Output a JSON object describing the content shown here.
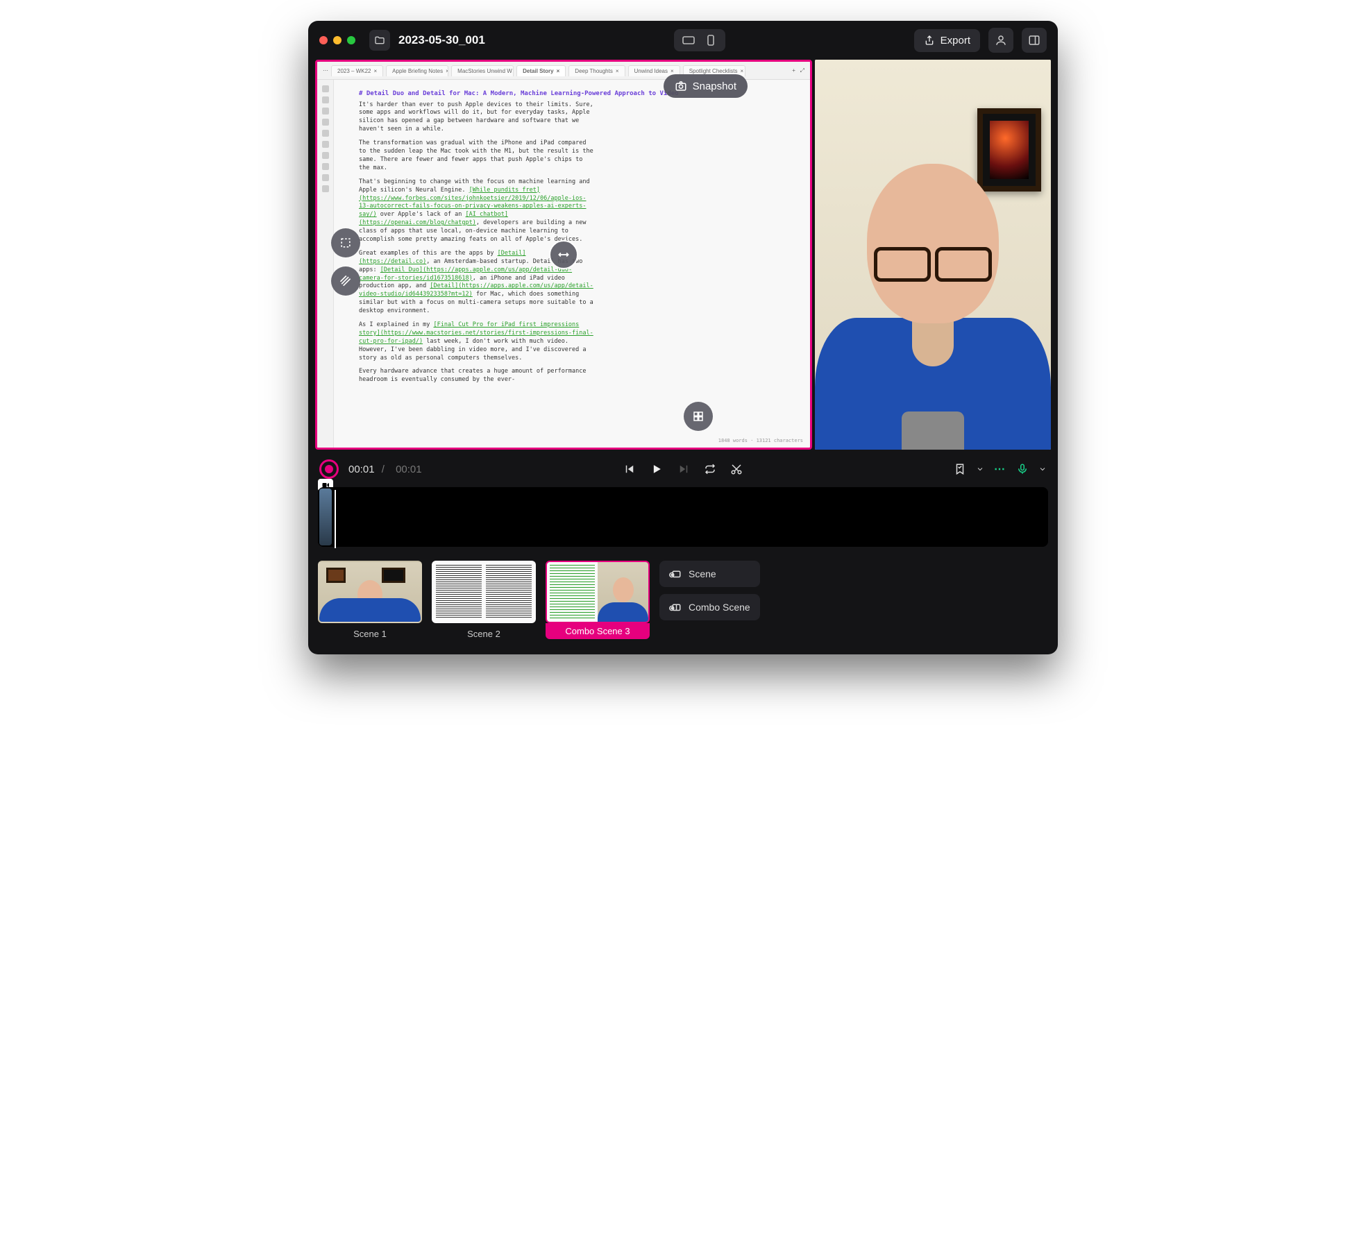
{
  "titlebar": {
    "project_name": "2023-05-30_001",
    "export_label": "Export"
  },
  "snapshot": {
    "label": "Snapshot"
  },
  "doc": {
    "tabs": [
      "2023 – WK22",
      "Apple Briefing Notes",
      "MacStories Unwind W…",
      "Detail Story",
      "Deep Thoughts",
      "Unwind Ideas",
      "Spotlight Checklists"
    ],
    "active_tab_index": 3,
    "heading": "# Detail Duo and Detail for Mac: A Modern, Machine Learning-Powered Approach to Video",
    "p1": "It's harder than ever to push Apple devices to their limits. Sure, some apps and workflows will do it, but for everyday tasks, Apple silicon has opened a gap between hardware and software that we haven't seen in a while.",
    "p2": "The transformation was gradual with the iPhone and iPad compared to the sudden leap the Mac took with the M1, but the result is the same. There are fewer and fewer apps that push Apple's chips to the max.",
    "p3a": "That's beginning to change with the focus on machine learning and Apple silicon's Neural Engine. ",
    "p3link1": "[While pundits fret](https://www.forbes.com/sites/johnkoetsier/2019/12/06/apple-ios-13-autocorrect-fails-focus-on-privacy-weakens-apples-ai-experts-say/)",
    "p3b": " over Apple's lack of an ",
    "p3link2": "[AI chatbot](https://openai.com/blog/chatgpt)",
    "p3c": ", developers are building a new class of apps that use local, on-device machine learning to accomplish some pretty amazing feats on all of Apple's devices.",
    "p4a": "Great examples of this are the apps by ",
    "p4link1": "[Detail](https://detail.co)",
    "p4b": ", an Amsterdam-based startup. Detail has two apps: ",
    "p4link2": "[Detail Duo](https://apps.apple.com/us/app/detail-duo-camera-for-stories/id1673518618)",
    "p4c": ", an iPhone and iPad video production app, and ",
    "p4link3": "[Detail](https://apps.apple.com/us/app/detail-video-studio/id6443923358?mt=12)",
    "p4d": " for Mac, which does something similar but with a focus on multi-camera setups more suitable to a desktop environment.",
    "p5a": "As I explained in my ",
    "p5link1": "[Final Cut Pro for iPad first impressions story](https://www.macstories.net/stories/first-impressions-final-cut-pro-for-ipad/)",
    "p5b": " last week, I don't work with much video. However, I've been dabbling in video more, and I've discovered a story as old as personal computers themselves.",
    "p6": "Every hardware advance that creates a huge amount of performance headroom is eventually consumed by the ever-",
    "footer_stats": "1848 words · 13121 characters"
  },
  "transport": {
    "current": "00:01",
    "total": "00:01"
  },
  "scenes": {
    "items": [
      {
        "label": "Scene 1"
      },
      {
        "label": "Scene 2"
      },
      {
        "label": "Combo Scene 3"
      }
    ],
    "selected_index": 2,
    "add_scene_label": "Scene",
    "add_combo_label": "Combo Scene"
  }
}
